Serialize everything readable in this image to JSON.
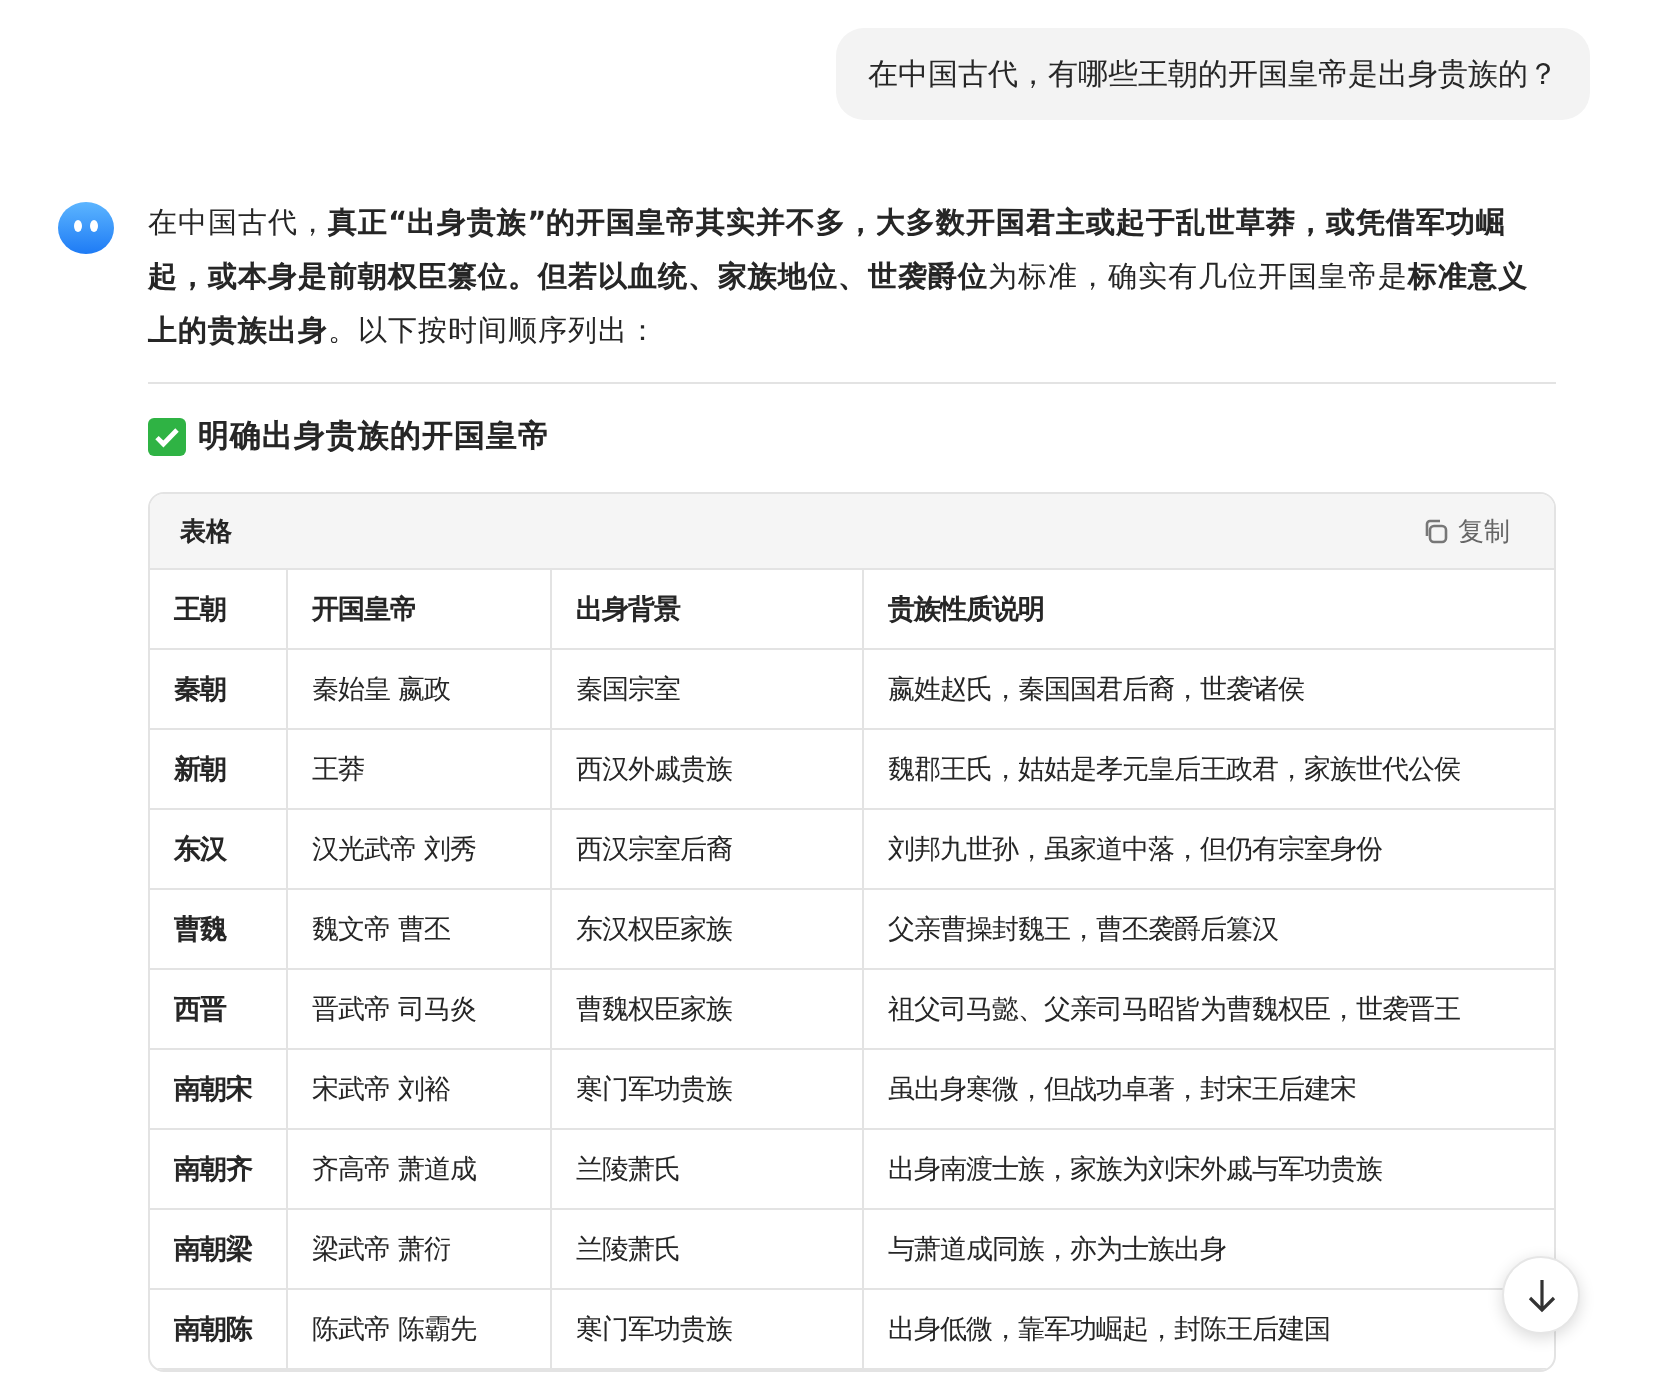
{
  "user_message": "在中国古代，有哪些王朝的开国皇帝是出身贵族的？",
  "answer": {
    "intro": "在中国古代，**真正“出身贵族”的开国皇帝其实并不多，大多数开国君主或起于乱世草莽，或凭借军功崛起，或本身是前朝权臣篡位。但若以血统、家族地位、世袭爵位**为标准，确实有几位开国皇帝是**标准意义上的贵族出身**。以下按时间顺序列出：",
    "section_title": "明确出身贵族的开国皇帝",
    "table": {
      "label": "表格",
      "copy_label": "复制",
      "columns": [
        "王朝",
        "开国皇帝",
        "出身背景",
        "贵族性质说明"
      ],
      "rows": [
        [
          "秦朝",
          "秦始皇 嬴政",
          "秦国宗室",
          "嬴姓赵氏，秦国国君后裔，世袭诸侯"
        ],
        [
          "新朝",
          "王莽",
          "西汉外戚贵族",
          "魏郡王氏，姑姑是孝元皇后王政君，家族世代公侯"
        ],
        [
          "东汉",
          "汉光武帝 刘秀",
          "西汉宗室后裔",
          "刘邦九世孙，虽家道中落，但仍有宗室身份"
        ],
        [
          "曹魏",
          "魏文帝 曹丕",
          "东汉权臣家族",
          "父亲曹操封魏王，曹丕袭爵后篡汉"
        ],
        [
          "西晋",
          "晋武帝 司马炎",
          "曹魏权臣家族",
          "祖父司马懿、父亲司马昭皆为曹魏权臣，世袭晋王"
        ],
        [
          "南朝宋",
          "宋武帝 刘裕",
          "寒门军功贵族",
          "虽出身寒微，但战功卓著，封宋王后建宋"
        ],
        [
          "南朝齐",
          "齐高帝 萧道成",
          "兰陵萧氏",
          "出身南渡士族，家族为刘宋外戚与军功贵族"
        ],
        [
          "南朝梁",
          "梁武帝 萧衍",
          "兰陵萧氏",
          "与萧道成同族，亦为士族出身"
        ],
        [
          "南朝陈",
          "陈武帝 陈霸先",
          "寒门军功贵族",
          "出身低微，靠军功崛起，封陈王后建国"
        ]
      ]
    }
  }
}
